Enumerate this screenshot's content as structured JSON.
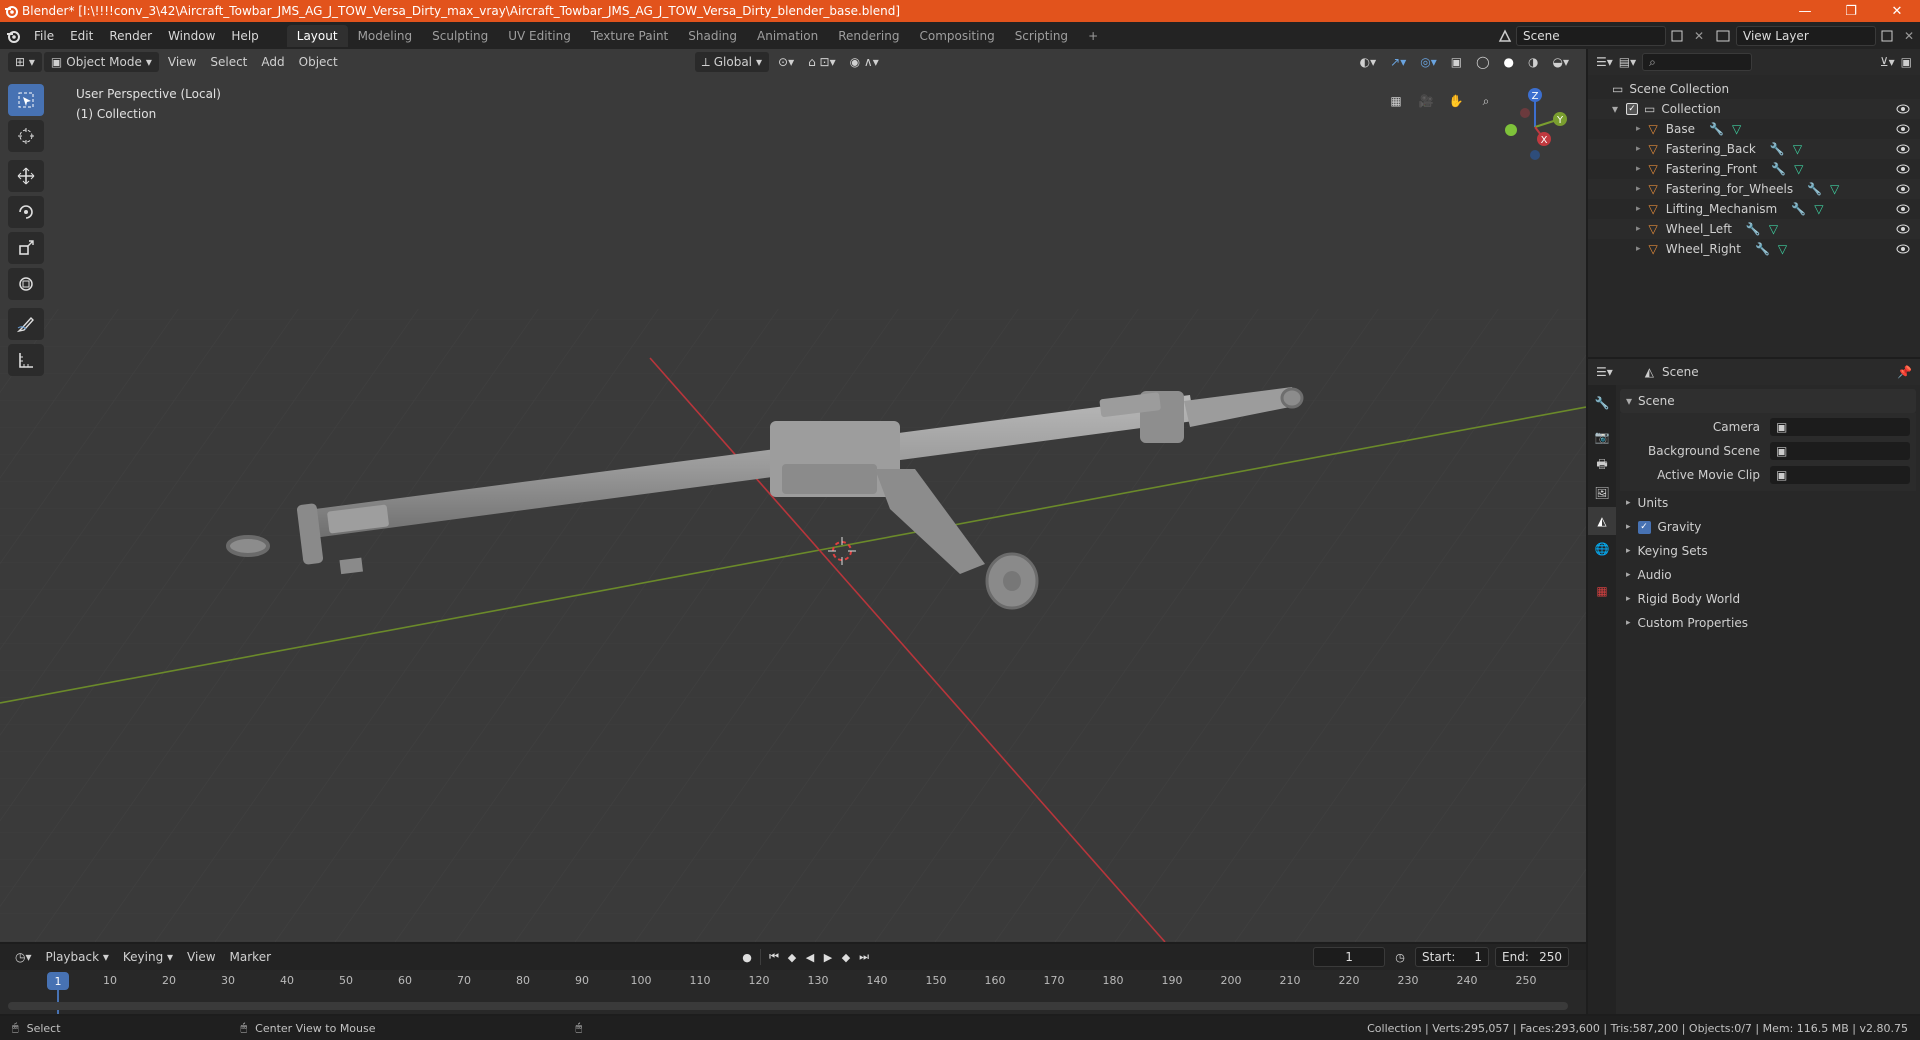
{
  "window": {
    "title": "Blender* [I:\\!!!!conv_3\\42\\Aircraft_Towbar_JMS_AG_J_TOW_Versa_Dirty_max_vray\\Aircraft_Towbar_JMS_AG_J_TOW_Versa_Dirty_blender_base.blend]",
    "minimize": "—",
    "maximize": "❐",
    "close": "✕"
  },
  "menu": [
    "File",
    "Edit",
    "Render",
    "Window",
    "Help"
  ],
  "workspaces": [
    "Layout",
    "Modeling",
    "Sculpting",
    "UV Editing",
    "Texture Paint",
    "Shading",
    "Animation",
    "Rendering",
    "Compositing",
    "Scripting"
  ],
  "active_workspace": "Layout",
  "add_workspace": "+",
  "scene_field": "Scene",
  "view_layer_field": "View Layer",
  "viewport": {
    "mode": "Object Mode",
    "menus": [
      "View",
      "Select",
      "Add",
      "Object"
    ],
    "orientation": "Global",
    "overlay_title": "User Perspective (Local)",
    "overlay_collection": "(1) Collection",
    "gizmo": {
      "x": "X",
      "y": "Y",
      "z": "Z"
    }
  },
  "outliner": {
    "root": "Scene Collection",
    "collection": "Collection",
    "objects": [
      "Base",
      "Fastering_Back",
      "Fastering_Front",
      "Fastering_for_Wheels",
      "Lifting_Mechanism",
      "Wheel_Left",
      "Wheel_Right"
    ]
  },
  "properties": {
    "context": "Scene",
    "panel_title": "Scene",
    "fields": [
      {
        "label": "Camera",
        "value": ""
      },
      {
        "label": "Background Scene",
        "value": ""
      },
      {
        "label": "Active Movie Clip",
        "value": ""
      }
    ],
    "sections": [
      "Units",
      "Gravity",
      "Keying Sets",
      "Audio",
      "Rigid Body World",
      "Custom Properties"
    ],
    "gravity_checked": true
  },
  "timeline": {
    "menus": [
      "Playback",
      "Keying",
      "View",
      "Marker"
    ],
    "current_frame": "1",
    "start_label": "Start:",
    "start": "1",
    "end_label": "End:",
    "end": "250",
    "ruler": [
      "10",
      "20",
      "30",
      "40",
      "50",
      "60",
      "70",
      "80",
      "90",
      "100",
      "110",
      "120",
      "130",
      "140",
      "150",
      "160",
      "170",
      "180",
      "190",
      "200",
      "210",
      "220",
      "230",
      "240",
      "250"
    ],
    "playhead": "1"
  },
  "status": {
    "left_action": "Select",
    "mid_action": "Center View to Mouse",
    "stats": "Collection | Verts:295,057 | Faces:293,600 | Tris:587,200 | Objects:0/7 | Mem: 116.5 MB | v2.80.75"
  },
  "colors": {
    "titlebar": "#e2531c",
    "accent": "#4772b3",
    "x_axis": "#c0393f",
    "y_axis": "#7a9e2f",
    "mesh_icon": "#e08a3a",
    "modifier_icon": "#6aa4e0",
    "data_icon": "#3fd0a0"
  }
}
